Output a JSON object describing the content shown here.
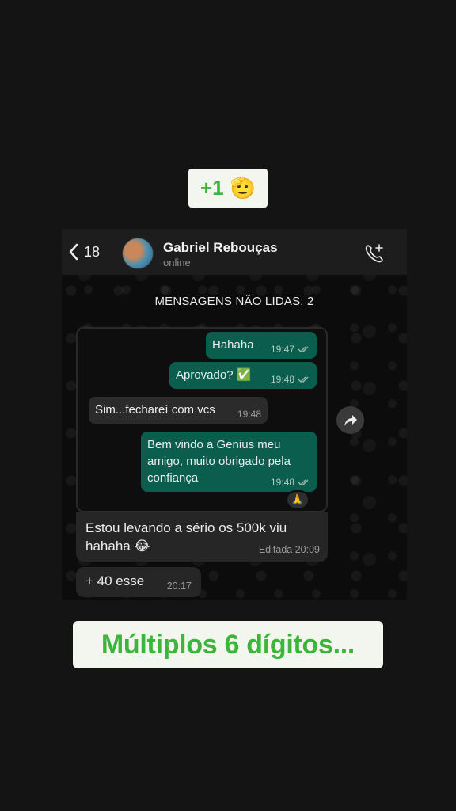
{
  "story": {
    "top_sticker": {
      "text": "+1",
      "emoji": "🫡"
    },
    "bottom_sticker": {
      "text": "Múltiplos 6 dígitos..."
    }
  },
  "header": {
    "back_count": "18",
    "contact_name": "Gabriel Rebouças",
    "contact_status": "online"
  },
  "unread_banner": "MENSAGENS NÃO LIDAS: 2",
  "quoted_messages": [
    {
      "text": "Hahaha",
      "time": "19:47",
      "direction": "out"
    },
    {
      "text": "Aprovado? ✅",
      "time": "19:48",
      "direction": "out"
    },
    {
      "text": "Sim...fechareí com vcs",
      "time": "19:48",
      "direction": "in"
    },
    {
      "text": "Bem vindo a Genius meu amigo, muito obrigado pela confiança",
      "time": "19:48",
      "direction": "out"
    }
  ],
  "reaction": "🙏",
  "reply_message": {
    "text": "Estou levando a sério os 500k viu hahaha 😂",
    "time": "Editada 20:09"
  },
  "last_message": {
    "text": "+ 40 esse",
    "time": "20:17"
  },
  "colors": {
    "accent_green": "#3db53d",
    "out_bubble": "#0b5e4e",
    "in_bubble": "#2b2b2b"
  }
}
